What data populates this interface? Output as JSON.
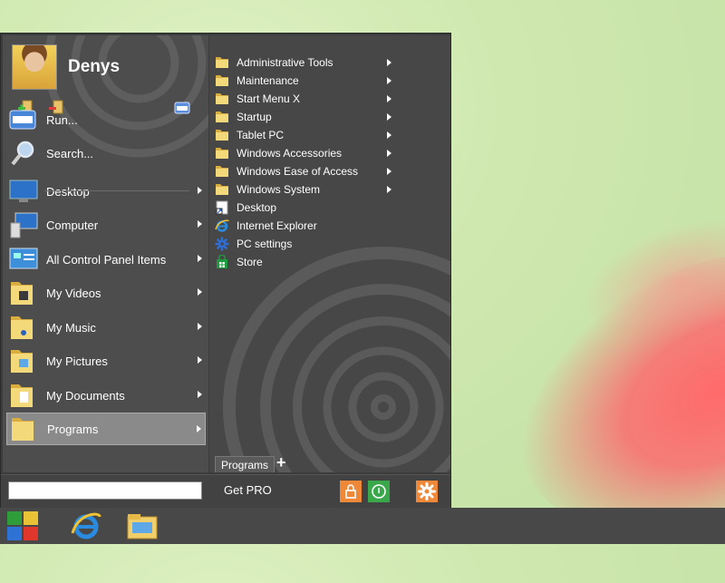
{
  "user": {
    "name": "Denys"
  },
  "left_menu": {
    "items": [
      {
        "label": "Run...",
        "icon": "run-icon",
        "submenu": false
      },
      {
        "label": "Search...",
        "icon": "search-icon",
        "submenu": false
      },
      {
        "label": "Desktop",
        "icon": "desktop-icon",
        "submenu": true
      },
      {
        "label": "Computer",
        "icon": "computer-icon",
        "submenu": true
      },
      {
        "label": "All Control Panel Items",
        "icon": "control-panel-icon",
        "submenu": true
      },
      {
        "label": "My Videos",
        "icon": "videos-folder-icon",
        "submenu": true
      },
      {
        "label": "My Music",
        "icon": "music-folder-icon",
        "submenu": true
      },
      {
        "label": "My Pictures",
        "icon": "pictures-folder-icon",
        "submenu": true
      },
      {
        "label": "My Documents",
        "icon": "documents-folder-icon",
        "submenu": true
      },
      {
        "label": "Programs",
        "icon": "programs-folder-icon",
        "submenu": true,
        "selected": true
      }
    ]
  },
  "programs": {
    "items": [
      {
        "label": "Administrative Tools",
        "icon": "folder-icon",
        "submenu": true
      },
      {
        "label": "Maintenance",
        "icon": "folder-icon",
        "submenu": true
      },
      {
        "label": "Start Menu X",
        "icon": "folder-icon",
        "submenu": true
      },
      {
        "label": "Startup",
        "icon": "folder-icon",
        "submenu": true
      },
      {
        "label": "Tablet PC",
        "icon": "folder-icon",
        "submenu": true
      },
      {
        "label": "Windows Accessories",
        "icon": "folder-icon",
        "submenu": true
      },
      {
        "label": "Windows Ease of Access",
        "icon": "folder-icon",
        "submenu": true
      },
      {
        "label": "Windows System",
        "icon": "folder-icon",
        "submenu": true
      },
      {
        "label": "Desktop",
        "icon": "desktop-shortcut-icon",
        "submenu": false
      },
      {
        "label": "Internet Explorer",
        "icon": "internet-explorer-icon",
        "submenu": false
      },
      {
        "label": "PC settings",
        "icon": "gear-icon",
        "submenu": false
      },
      {
        "label": "Store",
        "icon": "store-icon",
        "submenu": false
      }
    ]
  },
  "tabs": {
    "programs_label": "Programs",
    "add_label": "+"
  },
  "bottom": {
    "search_value": "",
    "get_pro_label": "Get PRO"
  },
  "colors": {
    "lock_button": "#f0883a",
    "power_button": "#3aa84a",
    "settings_button": "#f0883a",
    "menu_bg": "#3c3c3c"
  }
}
